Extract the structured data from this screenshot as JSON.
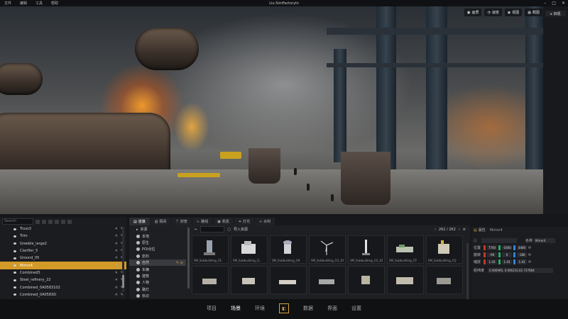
{
  "app": {
    "title": "Liu-SimFactoryIn",
    "menu": [
      "文件",
      "编辑",
      "工具",
      "帮助"
    ],
    "window_controls": [
      "–",
      "□",
      "✕"
    ]
  },
  "view_toolbar": [
    {
      "icon": "image-icon",
      "label": "画质"
    },
    {
      "icon": "speed-icon",
      "label": "速度"
    },
    {
      "icon": "view-icon",
      "label": "视图"
    },
    {
      "icon": "screenshot-icon",
      "label": "截图"
    }
  ],
  "side_strip": {
    "label": "▸ 目视"
  },
  "outliner": {
    "search_placeholder": "Search",
    "items": [
      {
        "name": "Truss3",
        "selected": false
      },
      {
        "name": "Trim",
        "selected": false
      },
      {
        "name": "Greeble_large2",
        "selected": false
      },
      {
        "name": "Clarifier_5",
        "selected": false
      },
      {
        "name": "Ground_05",
        "selected": false
      },
      {
        "name": "Mirror4",
        "selected": true
      },
      {
        "name": "Combined5",
        "selected": false
      },
      {
        "name": "Steel_refinery_22",
        "selected": false
      },
      {
        "name": "Combined_0A0583102",
        "selected": false
      },
      {
        "name": "Combined_0A0583D",
        "selected": false
      }
    ]
  },
  "resource_tabs": [
    {
      "label": "道旗",
      "active": true
    },
    {
      "label": "隔间",
      "active": false
    },
    {
      "label": "封管",
      "active": false
    },
    {
      "label": "路线",
      "active": false
    },
    {
      "label": "机机",
      "active": false
    },
    {
      "label": "灯光",
      "active": false
    },
    {
      "label": "水利",
      "active": false
    }
  ],
  "resource_tree": [
    {
      "label": "资源",
      "selected": false
    },
    {
      "label": "本地",
      "selected": false
    },
    {
      "label": "原生",
      "selected": false
    },
    {
      "label": "POI点位",
      "selected": false
    },
    {
      "label": "岩石",
      "selected": false
    },
    {
      "label": "自然",
      "selected": true
    },
    {
      "label": "车辆",
      "selected": false
    },
    {
      "label": "建筑",
      "selected": false
    },
    {
      "label": "人物",
      "selected": false
    },
    {
      "label": "路灯",
      "selected": false
    },
    {
      "label": "标识",
      "selected": false
    }
  ],
  "resource_grid": {
    "import_label": "导入资源",
    "count": "262 / 262",
    "items": [
      "SM_Subbuilding_CK",
      "SM_Subbuilding_CL",
      "SM_Subbuilding_CN",
      "SM_Subbuilding_CO_01",
      "SM_Subbuilding_CO_02",
      "SM_Subbuilding_CP",
      "SM_Subbuilding_CQ"
    ]
  },
  "properties": {
    "header": "属性",
    "object_name": "Mirror4",
    "name_label": "名称",
    "name_value": "Mirror4",
    "position_label": "位置",
    "position": [
      "7740",
      "-1600",
      "4400"
    ],
    "rotation_label": "旋转",
    "rotation": [
      "-90",
      "0",
      "-180"
    ],
    "scale_label": "缩放",
    "scale": [
      "1.43",
      "1.43",
      "1.43"
    ],
    "coords_label": "经纬度",
    "coords": "0.006995, 0.006231,62.737684"
  },
  "bottom_nav": [
    {
      "label": "项目",
      "active": false
    },
    {
      "label": "场景",
      "active": true
    },
    {
      "label": "环境",
      "active": false
    },
    {
      "label": "数据",
      "active": false
    },
    {
      "label": "界面",
      "active": false
    },
    {
      "label": "设置",
      "active": false
    }
  ]
}
